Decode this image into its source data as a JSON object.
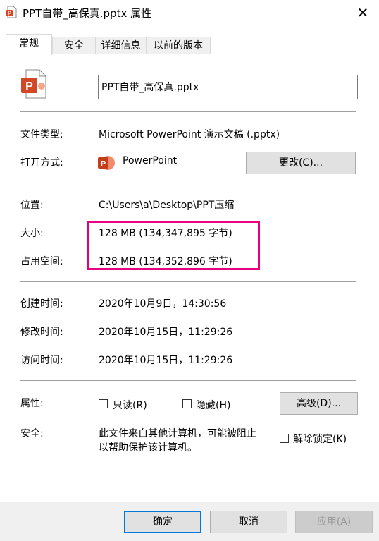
{
  "window": {
    "title": "PPT自带_高保真.pptx 属性",
    "close_glyph": "✕"
  },
  "tabs": [
    {
      "label": "常规",
      "active": true
    },
    {
      "label": "安全",
      "active": false
    },
    {
      "label": "详细信息",
      "active": false
    },
    {
      "label": "以前的版本",
      "active": false
    }
  ],
  "general": {
    "file_name": "PPT自带_高保真.pptx",
    "file_type_label": "文件类型:",
    "file_type_value": "Microsoft PowerPoint 演示文稿 (.pptx)",
    "open_with_label": "打开方式:",
    "open_with_value": "PowerPoint",
    "change_button": "更改(C)...",
    "location_label": "位置:",
    "location_value": "C:\\Users\\a\\Desktop\\PPT压缩",
    "size_label": "大小:",
    "size_value": "128 MB (134,347,895 字节)",
    "size_on_disk_label": "占用空间:",
    "size_on_disk_value": "128 MB (134,352,896 字节)",
    "created_label": "创建时间:",
    "created_value": "2020年10月9日，14:30:56",
    "modified_label": "修改时间:",
    "modified_value": "2020年10月15日，11:29:26",
    "accessed_label": "访问时间:",
    "accessed_value": "2020年10月15日，11:29:26",
    "attributes_label": "属性:",
    "readonly_label": "只读(R)",
    "hidden_label": "隐藏(H)",
    "advanced_button": "高级(D)...",
    "security_label": "安全:",
    "security_text_1": "此文件来自其他计算机，可能被阻止",
    "security_text_2": "以帮助保护该计算机。",
    "unblock_label": "解除锁定(K)"
  },
  "footer": {
    "ok": "确定",
    "cancel": "取消",
    "apply": "应用(A)"
  },
  "colors": {
    "highlight": "#e4007f",
    "powerpoint": "#d24726",
    "accent": "#0078d7"
  },
  "icons": {
    "file_icon": "powerpoint-file-icon",
    "app_icon": "powerpoint-app-icon"
  }
}
